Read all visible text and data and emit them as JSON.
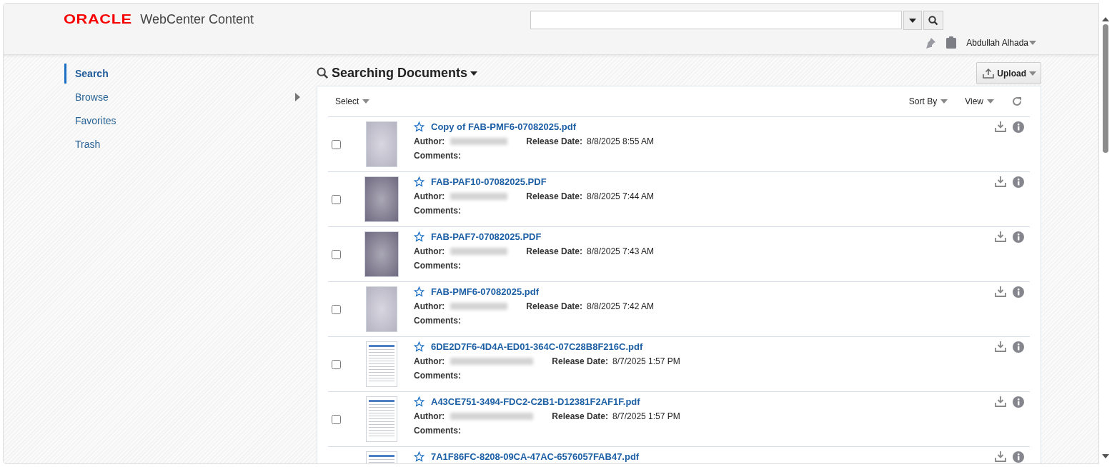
{
  "header": {
    "logo": "ORACLE",
    "product": "WebCenter Content",
    "user": "Abdullah Alhada"
  },
  "sidebar": {
    "items": [
      {
        "label": "Search",
        "selected": true,
        "has_submenu": false
      },
      {
        "label": "Browse",
        "selected": false,
        "has_submenu": true
      },
      {
        "label": "Favorites",
        "selected": false,
        "has_submenu": false
      },
      {
        "label": "Trash",
        "selected": false,
        "has_submenu": false
      }
    ]
  },
  "content": {
    "title": "Searching Documents",
    "upload_label": "Upload",
    "toolbar": {
      "select": "Select",
      "sort_by": "Sort By",
      "view": "View"
    },
    "documents": [
      {
        "title": "Copy of FAB-PMF6-07082025.pdf",
        "kind": "light",
        "checked": false,
        "favorite": false,
        "author_label": "Author:",
        "date_label": "Release Date:",
        "release_date": "8/8/2025 8:55 AM",
        "comments_label": "Comments:"
      },
      {
        "title": "FAB-PAF10-07082025.PDF",
        "kind": "dark",
        "checked": false,
        "favorite": false,
        "author_label": "Author:",
        "date_label": "Release Date:",
        "release_date": "8/8/2025 7:44 AM",
        "comments_label": "Comments:"
      },
      {
        "title": "FAB-PAF7-07082025.PDF",
        "kind": "dark",
        "checked": false,
        "favorite": false,
        "author_label": "Author:",
        "date_label": "Release Date:",
        "release_date": "8/8/2025 7:43 AM",
        "comments_label": "Comments:"
      },
      {
        "title": "FAB-PMF6-07082025.pdf",
        "kind": "light",
        "checked": false,
        "favorite": false,
        "author_label": "Author:",
        "date_label": "Release Date:",
        "release_date": "8/8/2025 7:42 AM",
        "comments_label": "Comments:"
      },
      {
        "title": "6DE2D7F6-4D4A-ED01-364C-07C28B8F216C.pdf",
        "kind": "table",
        "checked": false,
        "favorite": false,
        "author_label": "Author:",
        "date_label": "Release Date:",
        "release_date": "8/7/2025 1:57 PM",
        "comments_label": "Comments:"
      },
      {
        "title": "A43CE751-3494-FDC2-C2B1-D12381F2AF1F.pdf",
        "kind": "table",
        "checked": false,
        "favorite": false,
        "author_label": "Author:",
        "date_label": "Release Date:",
        "release_date": "8/7/2025 1:57 PM",
        "comments_label": "Comments:"
      },
      {
        "title": "7A1F86FC-8208-09CA-47AC-6576057FAB47.pdf",
        "kind": "table",
        "favorite": false
      }
    ]
  }
}
